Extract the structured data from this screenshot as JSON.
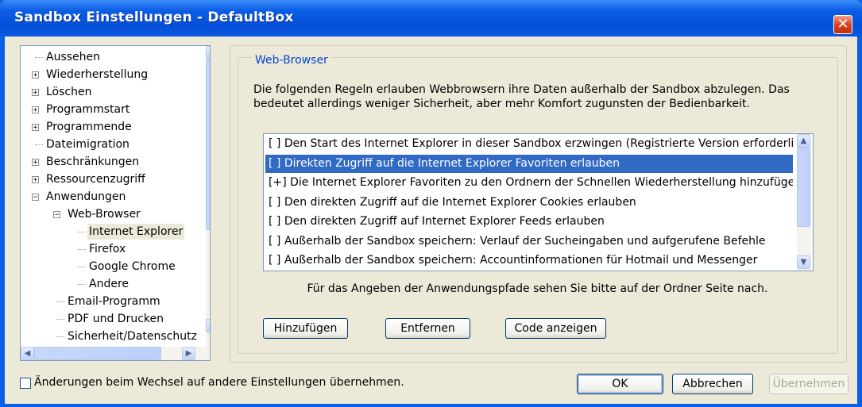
{
  "window": {
    "title": "Sandbox Einstellungen - DefaultBox",
    "close_glyph": "✕"
  },
  "tree": {
    "items": [
      {
        "label": "Aussehen",
        "expander": ""
      },
      {
        "label": "Wiederherstellung",
        "expander": "+"
      },
      {
        "label": "Löschen",
        "expander": "+"
      },
      {
        "label": "Programmstart",
        "expander": "+"
      },
      {
        "label": "Programmende",
        "expander": "+"
      },
      {
        "label": "Dateimigration",
        "expander": ""
      },
      {
        "label": "Beschränkungen",
        "expander": "+"
      },
      {
        "label": "Ressourcenzugriff",
        "expander": "+"
      },
      {
        "label": "Anwendungen",
        "expander": "−"
      },
      {
        "label": "Web-Browser",
        "expander": "−"
      },
      {
        "label": "Internet Explorer",
        "expander": ""
      },
      {
        "label": "Firefox",
        "expander": ""
      },
      {
        "label": "Google Chrome",
        "expander": ""
      },
      {
        "label": "Andere",
        "expander": ""
      },
      {
        "label": "Email-Programm",
        "expander": ""
      },
      {
        "label": "PDF und Drucken",
        "expander": ""
      },
      {
        "label": "Sicherheit/Datenschutz",
        "expander": ""
      }
    ],
    "scroll_up": "▲",
    "scroll_down": "▼",
    "scroll_left": "◀",
    "scroll_right": "▶"
  },
  "group": {
    "legend": "Web-Browser",
    "desc_line1": "Die folgenden Regeln erlauben Webbrowsern ihre Daten außerhalb der Sandbox abzulegen. Das",
    "desc_line2": "bedeutet allerdings weniger Sicherheit, aber mehr Komfort zugunsten der Bedienbarkeit.",
    "rules": [
      "[ ]  Den Start des Internet Explorer in dieser Sandbox erzwingen (Registrierte Version erforderlich)",
      "[ ]  Direkten Zugriff auf die Internet Explorer Favoriten erlauben",
      "[+]  Die Internet Explorer Favoriten zu den Ordnern der Schnellen Wiederherstellung hinzufügen",
      "[ ]  Den direkten Zugriff auf die Internet Explorer Cookies erlauben",
      "[ ]  Den direkten Zugriff auf Internet Explorer Feeds erlauben",
      "[ ]  Außerhalb der Sandbox speichern: Verlauf der Sucheingaben und aufgerufene Befehle",
      "[ ]  Außerhalb der Sandbox speichern: Accountinformationen für Hotmail und Messenger"
    ],
    "selected_rule_index": 1,
    "hint": "Für das Angeben der Anwendungspfade sehen Sie bitte auf der Ordner Seite nach.",
    "add_button": "Hinzufügen",
    "remove_button": "Entfernen",
    "show_code_button": "Code anzeigen"
  },
  "footer": {
    "checkbox_label": "Änderungen beim Wechsel auf andere Einstellungen übernehmen.",
    "ok_button": "OK",
    "cancel_button": "Abbrechen",
    "apply_button": "Übernehmen"
  },
  "colors": {
    "title_bar": "#0a5ce6",
    "selection": "#316ac5",
    "dialog_bg": "#ece9d8",
    "legend": "#0046d5"
  }
}
